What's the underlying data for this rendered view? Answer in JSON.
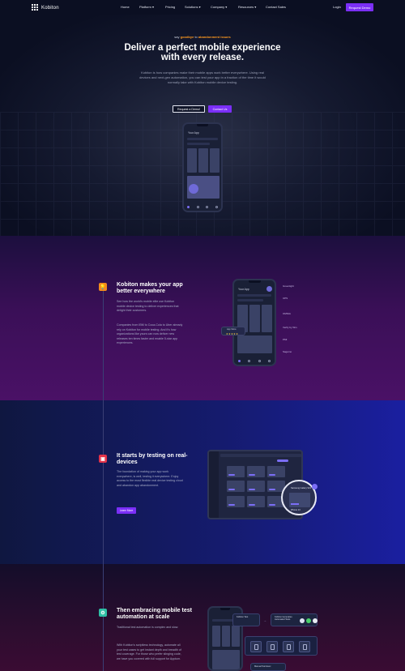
{
  "brand": {
    "name": "Kobiton"
  },
  "nav": {
    "links": [
      {
        "label": "Home"
      },
      {
        "label": "Platform ▾"
      },
      {
        "label": "Pricing"
      },
      {
        "label": "Solutions ▾"
      },
      {
        "label": "Company ▾"
      },
      {
        "label": "Resources ▾"
      },
      {
        "label": "Contact Sales"
      }
    ],
    "login": "Login",
    "cta": "Request Demo"
  },
  "hero": {
    "eyebrow_pre": "say",
    "eyebrow_hl1": "goodbye",
    "eyebrow_mid": "to",
    "eyebrow_hl2": "abandonment issues",
    "title": "Deliver a perfect mobile experience with every release.",
    "description": "Kobiton is how companies make their mobile apps work better everywhere. Using real devices and next-gen automation, you can test your app in a fraction of the time it would normally take with Kobiton mobile device testing.",
    "btn_demo": "Request a Demo!",
    "btn_contact": "Contact Us",
    "phone_title": "Your App"
  },
  "section_better": {
    "title": "Kobiton makes your app better everywhere",
    "para1": "See how the world's mobile elite use Kobiton mobile device testing to deliver experiences that delight their customers.",
    "para2": "Companies from IBM to Coca-Cola to Uber already rely on Kobiton for mobile testing. And it's how organizations like yours can now deliver new releases ten times faster and enable 5-star app experiences.",
    "phone_title": "Your App",
    "rating_title": "App Store",
    "rating_stars": "★★★★★",
    "logos": [
      "Greenlight",
      "UPS",
      "OMNIA",
      "Verify by Wm",
      "PMI",
      "Sagemo"
    ]
  },
  "section_testing": {
    "title": "It starts by testing on real-devices",
    "para": "The foundation of making your app work everywhere, is well, testing it everywhere. Enjoy access to the most flexible real device testing cloud and abandon app abandonment.",
    "button": "Learn More",
    "magnifier_title": "Samsung Galaxy S21",
    "magnifier_label": "iPhone 13"
  },
  "section_automation": {
    "title": "Then embracing mobile test automation at scale",
    "para1": "Traditional test automation is complex and slow.",
    "para2": "With Kobiton's scriptless technology, automate all your test cases to get instant depth and breadth of test coverage. For those who prefer slinging code, we have you covered with full support for Appium.",
    "chip_left": "Kobiton Test",
    "chip_mid": "Kobiton Generates Automated Tests",
    "chip_bottom": "Manual Test Exec"
  },
  "icons": {
    "s2": "lightbulb-icon",
    "s3": "device-icon",
    "s4": "automation-icon"
  },
  "colors": {
    "accent": "#7b2ff7",
    "highlight": "#ff9a1f",
    "s2_icon": "#f28b1d",
    "s3_icon": "#e2334a",
    "s4_icon": "#2fbfa5"
  }
}
